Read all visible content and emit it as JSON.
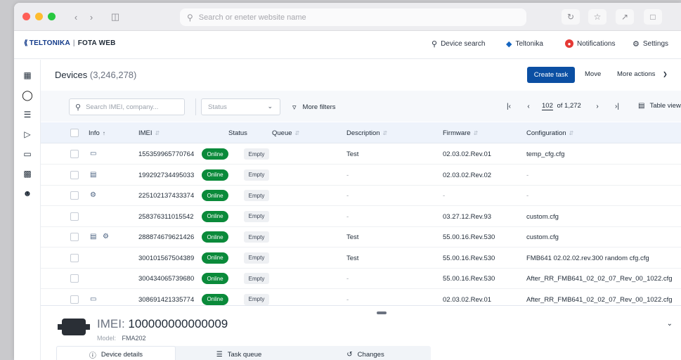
{
  "browser": {
    "url_placeholder": "Search or eneter website name"
  },
  "header": {
    "logo_brand": "TELTONIKA",
    "logo_separator": "|",
    "logo_product": "FOTA WEB",
    "nav": [
      {
        "label": "Device search",
        "icon": "device-search-icon"
      },
      {
        "label": "Teltonika",
        "icon": "teltonika-icon"
      },
      {
        "label": "Notifications",
        "icon": "notification-icon"
      },
      {
        "label": "Settings",
        "icon": "gear-icon"
      }
    ]
  },
  "page": {
    "title": "Devices",
    "count": "(3,246,278)",
    "create_task": "Create task",
    "move": "Move",
    "more_actions": "More actions"
  },
  "toolbar": {
    "search_placeholder": "Search IMEI, company...",
    "status_placeholder": "Status",
    "more_filters": "More filters",
    "current_page": "102",
    "total_pages": "of 1,272",
    "table_view": "Table view"
  },
  "table": {
    "columns": [
      "Info",
      "IMEI",
      "Status",
      "Queue",
      "Description",
      "Firmware",
      "Configuration"
    ],
    "rows": [
      {
        "info": [
          "device-icon"
        ],
        "imei": "155359965770764",
        "status": "Online",
        "queue": "Empty",
        "description": "Test",
        "firmware": "02.03.02.Rev.01",
        "configuration": "temp_cfg.cfg"
      },
      {
        "info": [
          "chat-icon"
        ],
        "imei": "199292734495033",
        "status": "Online",
        "queue": "Empty",
        "description": "-",
        "firmware": "02.03.02.Rev.02",
        "configuration": "-"
      },
      {
        "info": [
          "settings-icon"
        ],
        "imei": "225102137433374",
        "status": "Online",
        "queue": "Empty",
        "description": "-",
        "firmware": "-",
        "configuration": "-"
      },
      {
        "info": [],
        "imei": "258376311015542",
        "status": "Online",
        "queue": "Empty",
        "description": "-",
        "firmware": "03.27.12.Rev.93",
        "configuration": "custom.cfg"
      },
      {
        "info": [
          "chat-icon",
          "settings-icon"
        ],
        "imei": "288874679621426",
        "status": "Online",
        "queue": "Empty",
        "description": "Test",
        "firmware": "55.00.16.Rev.530",
        "configuration": "custom.cfg"
      },
      {
        "info": [],
        "imei": "300101567504389",
        "status": "Online",
        "queue": "Empty",
        "description": "Test",
        "firmware": "55.00.16.Rev.530",
        "configuration": "FMB641 02.02.02.rev.300 random cfg.cfg"
      },
      {
        "info": [],
        "imei": "300434065739680",
        "status": "Online",
        "queue": "Empty",
        "description": "-",
        "firmware": "55.00.16.Rev.530",
        "configuration": "After_RR_FMB641_02_02_07_Rev_00_1022.cfg"
      },
      {
        "info": [
          "device-icon"
        ],
        "imei": "308691421335774",
        "status": "Online",
        "queue": "Empty",
        "description": "-",
        "firmware": "02.03.02.Rev.01",
        "configuration": "After_RR_FMB641_02_02_07_Rev_00_1022.cfg"
      }
    ]
  },
  "panel": {
    "imei_label": "IMEI:",
    "imei_value": "100000000000009",
    "model_label": "Model:",
    "model_value": "FMA202",
    "tabs": [
      {
        "label": "Device details",
        "icon": "info-icon"
      },
      {
        "label": "Task queue",
        "icon": "list-icon"
      },
      {
        "label": "Changes",
        "icon": "history-icon"
      }
    ]
  },
  "colors": {
    "primary": "#0b4fa3",
    "online": "#0a8a3a",
    "header_row": "#eef3fb"
  }
}
